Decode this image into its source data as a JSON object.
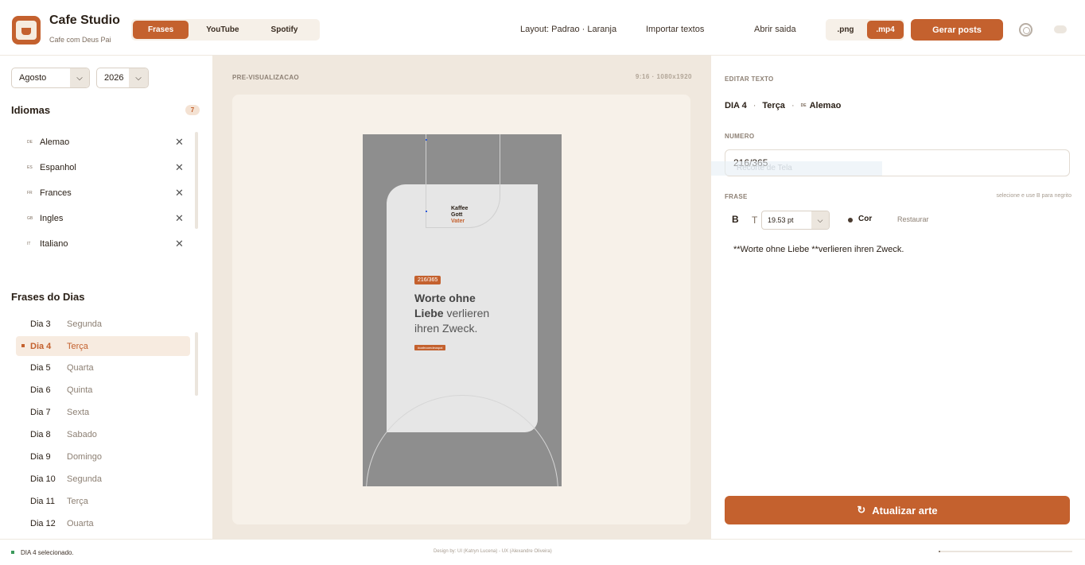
{
  "header": {
    "app_title": "Cafe Studio",
    "app_subtitle": "Cafe com Deus Pai",
    "tabs": [
      {
        "label": "Frases",
        "active": true
      },
      {
        "label": "YouTube",
        "active": false
      },
      {
        "label": "Spotify",
        "active": false
      }
    ],
    "layout_link": "Layout: Padrao · Laranja",
    "import_link": "Importar textos",
    "open_output_link": "Abrir saida",
    "formats": [
      {
        "label": ".png",
        "active": false
      },
      {
        "label": ".mp4",
        "active": true
      }
    ],
    "generate_button": "Gerar posts",
    "icons": {
      "settings": "gear-icon",
      "theme": "toggle-icon"
    }
  },
  "sidebar": {
    "month": "Agosto",
    "year": "2026",
    "languages_title": "Idiomas",
    "languages_count": "7",
    "languages": [
      {
        "code": "DE",
        "name": "Alemao"
      },
      {
        "code": "ES",
        "name": "Espanhol"
      },
      {
        "code": "FR",
        "name": "Frances"
      },
      {
        "code": "GB",
        "name": "Ingles"
      },
      {
        "code": "IT",
        "name": "Italiano"
      }
    ],
    "days_title": "Frases do Dias",
    "days": [
      {
        "num": "Dia 3",
        "name": "Segunda",
        "active": false
      },
      {
        "num": "Dia 4",
        "name": "Terça",
        "active": true
      },
      {
        "num": "Dia 5",
        "name": "Quarta",
        "active": false
      },
      {
        "num": "Dia 6",
        "name": "Quinta",
        "active": false
      },
      {
        "num": "Dia 7",
        "name": "Sexta",
        "active": false
      },
      {
        "num": "Dia 8",
        "name": "Sabado",
        "active": false
      },
      {
        "num": "Dia 9",
        "name": "Domingo",
        "active": false
      },
      {
        "num": "Dia 10",
        "name": "Segunda",
        "active": false
      },
      {
        "num": "Dia 11",
        "name": "Terça",
        "active": false
      },
      {
        "num": "Dia 12",
        "name": "Quarta",
        "active": false
      }
    ]
  },
  "preview": {
    "label": "PRE-VISUALIZACAO",
    "dims": "9:16 · 1080x1920",
    "art": {
      "brand_line1": "Kaffee",
      "brand_line2": "Gott",
      "brand_line3": "Vater",
      "badge": "216/365",
      "quote_bold_1": "Worte ohne",
      "quote_bold_2": "Liebe",
      "quote_rest_1": " verlieren",
      "quote_rest_2": "ihren Zweck.",
      "tag": "#cafecomdeuspai"
    }
  },
  "editor": {
    "section_label": "EDITAR TEXTO",
    "crumb_day": "DIA 4",
    "crumb_weekday": "Terça",
    "crumb_lang_code": "DE",
    "crumb_lang": "Alemao",
    "number_label": "NUMERO",
    "number_value": "216/365",
    "ghost_text": "Recorte de Tela",
    "phrase_label": "FRASE",
    "hint": "selecione e use B para negrito",
    "bold_label": "B",
    "size_label": "T",
    "font_size": "19.53 pt",
    "color_label": "Cor",
    "reset_label": "Restaurar",
    "phrase_value": "**Worte ohne Liebe **verlieren ihren Zweck.",
    "update_button": "Atualizar arte"
  },
  "footer": {
    "status": "DIA 4 selecionado.",
    "credit": "Design by: UI (Katryn Lucena) - UX (Alexandre Oliveira)",
    "progress": 0.01
  },
  "colors": {
    "accent": "#c4612e",
    "preview_bg": "#f0e8de",
    "art_bg": "#8e8e8e",
    "status_ok": "#3a9a5b"
  }
}
